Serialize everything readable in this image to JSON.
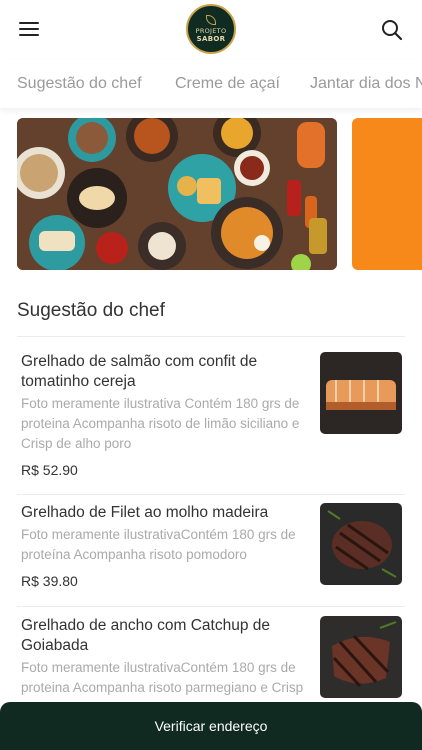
{
  "header": {
    "logo_line1": "PROJETO",
    "logo_line2": "SABOR"
  },
  "tabs": [
    {
      "label": "Sugestão do chef"
    },
    {
      "label": "Creme de açaí"
    },
    {
      "label": "Jantar dia dos N"
    }
  ],
  "section": {
    "title": "Sugestão do chef"
  },
  "items": [
    {
      "name": "Grelhado de salmão com confit de tomatinho cereja",
      "description": "Foto meramente ilustrativa Contém 180 grs de proteina Acompanha risoto de limão siciliano e Crisp de alho poro",
      "price": "R$ 52.90"
    },
    {
      "name": "Grelhado de Filet ao molho madeira",
      "description": "Foto meramente ilustrativaContém 180 grs de proteína Acompanha risoto pomodoro",
      "price": "R$ 39.80"
    },
    {
      "name": "Grelhado de ancho com Catchup de Goiabada",
      "description": "Foto meramente ilustrativaContém 180 grs de proteina Acompanha risoto parmegiano e Crisp de Cebola",
      "price": ""
    }
  ],
  "bottom_bar": {
    "label": "Verificar endereço"
  },
  "colors": {
    "dark_green": "#102a22",
    "banner_orange": "#f7891a",
    "muted_text": "#aaaaaa"
  }
}
